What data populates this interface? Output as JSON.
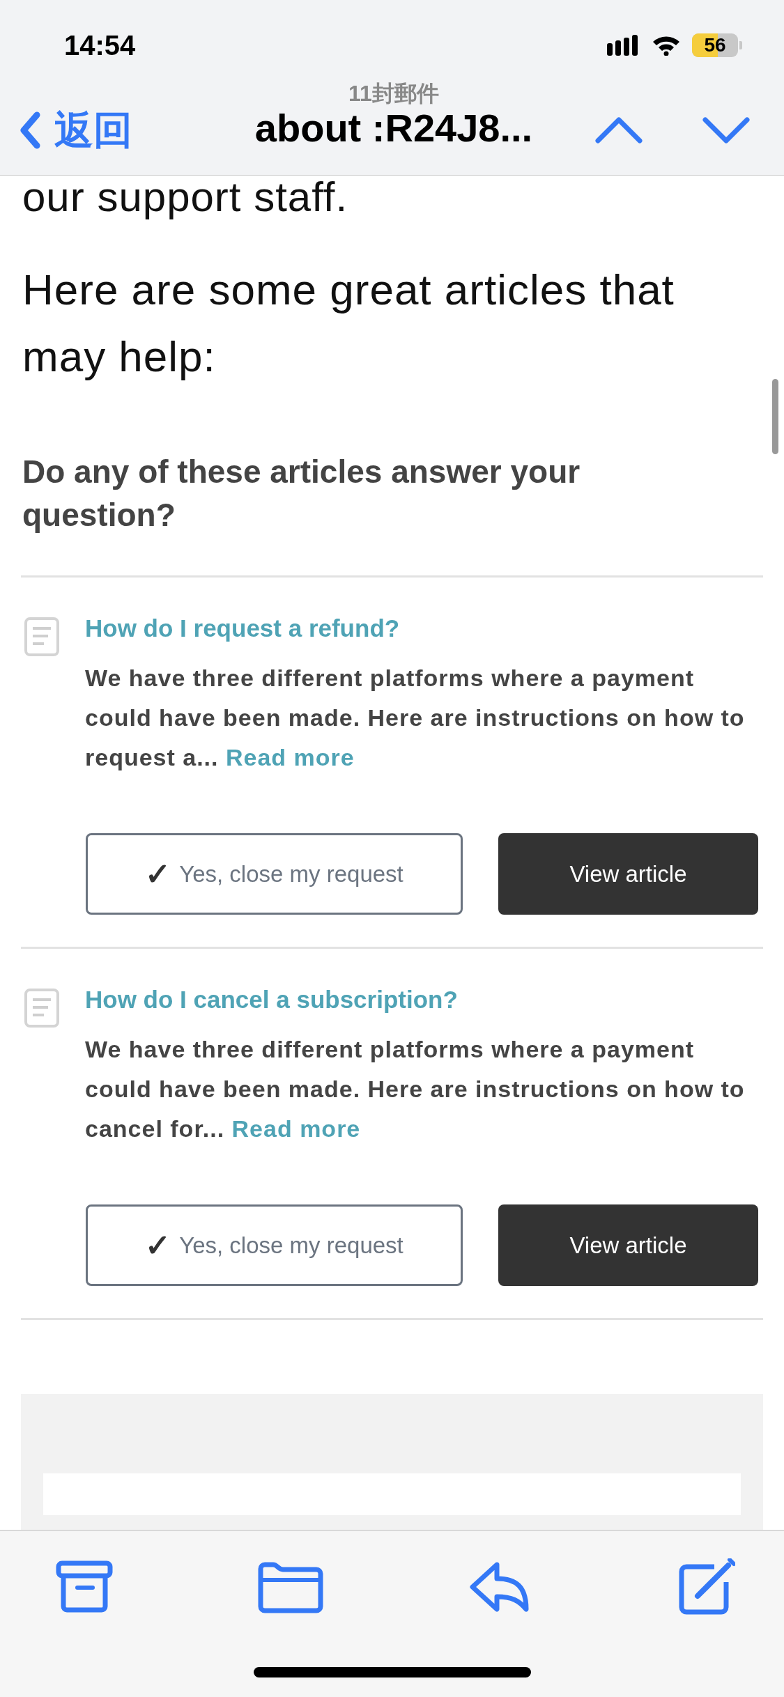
{
  "status_bar": {
    "time": "14:54",
    "battery": "56"
  },
  "nav": {
    "back": "返回",
    "count": "11封郵件",
    "title": "about :R24J8..."
  },
  "body": {
    "cut_line": "our support staff.",
    "intro": "Here are some great articles that may help:",
    "question": "Do any of these articles answer your question?"
  },
  "articles": [
    {
      "title": "How do I request a refund?",
      "excerpt": "We have three different platforms where a payment could have been made. Here are instructions on how to request a...",
      "read_more": "Read more",
      "close_button": "Yes, close my request",
      "close_mark": "✓",
      "view_button": "View article"
    },
    {
      "title": "How do I cancel a subscription?",
      "excerpt": "We have three different platforms where a payment could have been made. Here are instructions on how to cancel for...",
      "read_more": "Read more",
      "close_button": "Yes, close my request",
      "close_mark": "✓",
      "view_button": "View article"
    }
  ]
}
